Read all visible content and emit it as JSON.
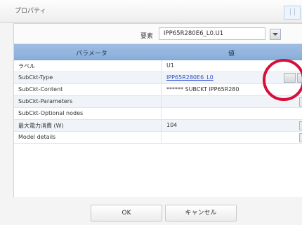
{
  "window": {
    "title": "プロパティ"
  },
  "element": {
    "label": "要素",
    "selected": "IPP65R280E6_L0.U1"
  },
  "grid": {
    "headers": [
      "パラメータ",
      "値"
    ],
    "rows": [
      {
        "name": "ラベル",
        "value": ""
      },
      {
        "name": "SubCkt-Type",
        "value": "IPP65R280E6_L0"
      },
      {
        "name": "SubCkt-Content",
        "value": "****** SUBCKT IPP65R280"
      },
      {
        "name": "SubCkt-Parameters",
        "value": ""
      },
      {
        "name": "SubCkt-Optional nodes",
        "value": ""
      },
      {
        "name": "最大電力消費 (W)",
        "value": "104"
      },
      {
        "name": "Model details",
        "value": ""
      }
    ],
    "label_value": "U1"
  },
  "buttons": {
    "ok": "OK",
    "cancel": "キャンセル"
  },
  "colors": {
    "accent": "#8aaedb",
    "highlight_circle": "#d5103a"
  }
}
